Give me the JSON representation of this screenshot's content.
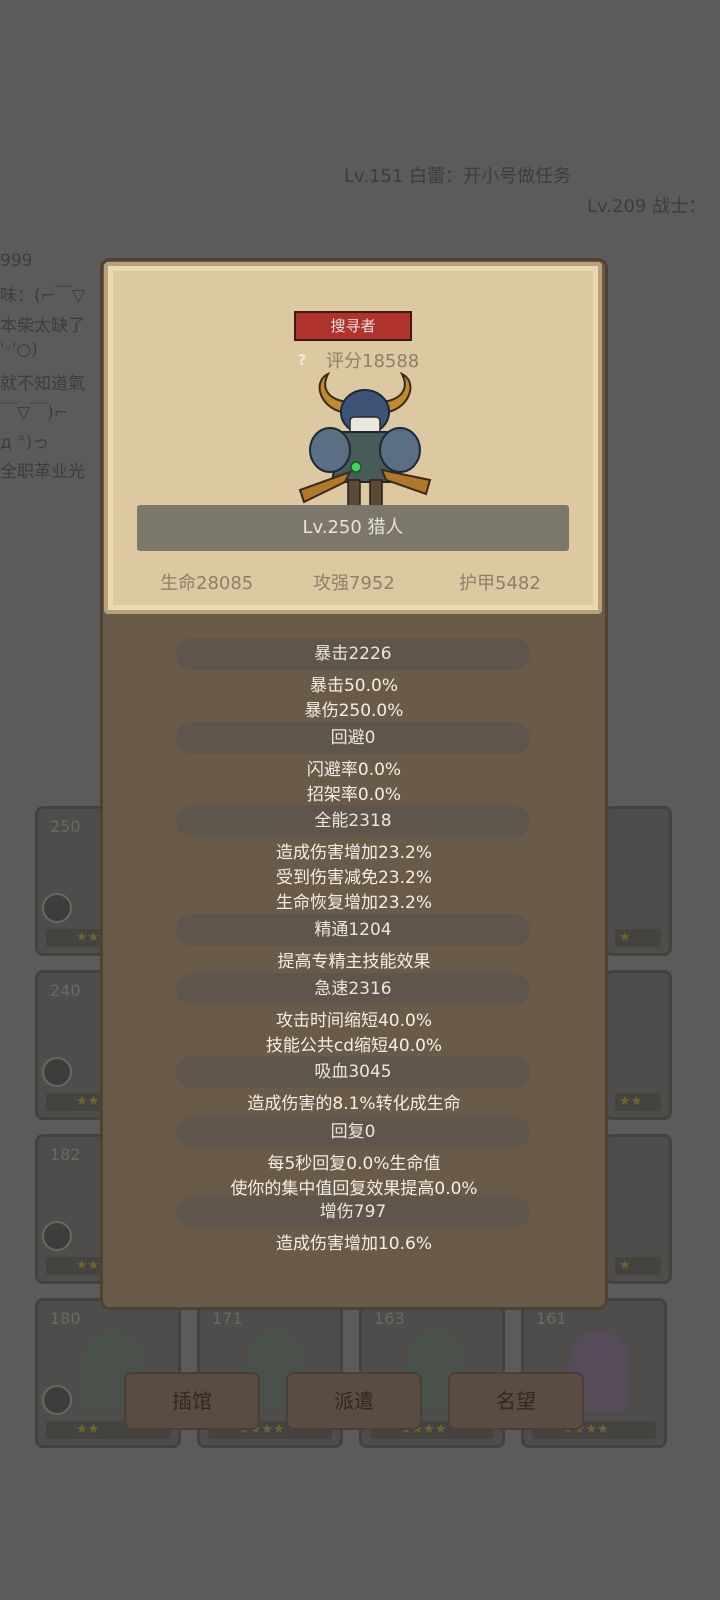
{
  "background": {
    "chat_top": [
      "Lv.151 白蕾：开小号做任务",
      "Lv.209 战士："
    ],
    "chat_side": [
      "999",
      "味：(⌐￣▽",
      "本柴太缺了",
      "'ᵕ'○)",
      "就不知道氣",
      "￣▽￣)⌐",
      "д °)っ",
      "全职革业光"
    ],
    "cards": [
      {
        "level": "250",
        "stars": "★★"
      },
      {
        "level": "240",
        "stars": "★★"
      },
      {
        "level": "182",
        "stars": "★★"
      },
      {
        "level": "180",
        "stars": "★★"
      },
      {
        "level": "171",
        "stars": "★★★★"
      },
      {
        "level": "163",
        "stars": "★★★★"
      },
      {
        "level": "161",
        "stars": "★★★★"
      },
      {
        "level": "",
        "stars": "★"
      },
      {
        "level": "",
        "stars": "★★"
      },
      {
        "level": "",
        "stars": "★"
      }
    ],
    "bottom_buttons": [
      "插馆",
      "派遣",
      "名望"
    ]
  },
  "profile": {
    "job_tag": "搜寻者",
    "help_icon": "?",
    "score": "评分18588",
    "name": "Lv.250 猎人",
    "hp": "生命28085",
    "attack": "攻强7952",
    "armor": "护甲5482"
  },
  "stats": [
    {
      "title": "暴击2226",
      "details": [
        "暴击50.0%",
        "暴伤250.0%"
      ]
    },
    {
      "title": "回避0",
      "details": [
        "闪避率0.0%",
        "招架率0.0%"
      ]
    },
    {
      "title": "全能2318",
      "details": [
        "造成伤害增加23.2%",
        "受到伤害减免23.2%",
        "生命恢复增加23.2%"
      ]
    },
    {
      "title": "精通1204",
      "details": [
        "提高专精主技能效果"
      ]
    },
    {
      "title": "急速2316",
      "details": [
        "攻击时间缩短40.0%",
        "技能公共cd缩短40.0%"
      ]
    },
    {
      "title": "吸血3045",
      "details": [
        "造成伤害的8.1%转化成生命"
      ]
    },
    {
      "title": "回复0",
      "details": [
        "每5秒回复0.0%生命值",
        "使你的集中值回复效果提高0.0%"
      ]
    },
    {
      "title": "增伤797",
      "details": [
        "造成伤害增加10.6%"
      ]
    }
  ],
  "colors": {
    "overlay_bg": "#5d5b59",
    "panel": "#6a5a48",
    "paper": "#dcc9a1",
    "job_tag": "#b0322d",
    "name_bar": "#7c776d"
  }
}
